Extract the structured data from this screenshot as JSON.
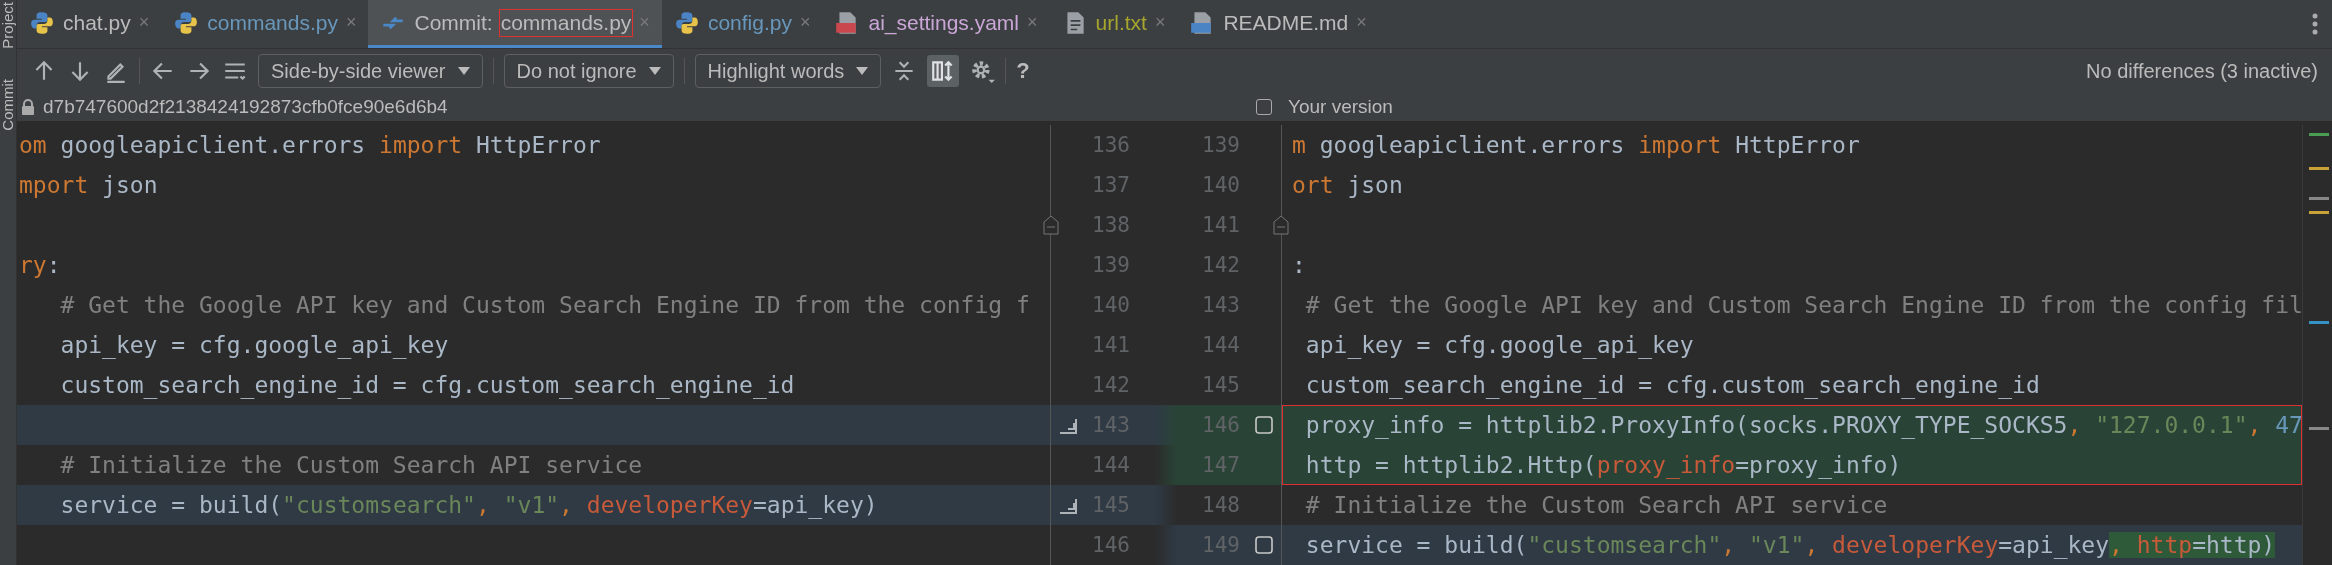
{
  "side_tabs": [
    {
      "label": "Project"
    },
    {
      "label": "Commit"
    }
  ],
  "tabs": [
    {
      "kind": "python",
      "label": "chat.py",
      "close": "×",
      "color": "#bbbbbb",
      "selected": false
    },
    {
      "kind": "python",
      "label": "commands.py",
      "close": "×",
      "color": "#6897bb",
      "selected": false
    },
    {
      "kind": "commit",
      "label": "Commit:",
      "file": "commands.py",
      "file_boxed": true,
      "close": "×",
      "color": "#bbbbbb",
      "selected": true
    },
    {
      "kind": "python",
      "label": "config.py",
      "close": "×",
      "color": "#6897bb",
      "selected": false
    },
    {
      "kind": "yaml",
      "label": "ai_settings.yaml",
      "close": "×",
      "color": "#c9a6d6",
      "selected": false
    },
    {
      "kind": "text",
      "label": "url.txt",
      "close": "×",
      "color": "#a6a62e",
      "selected": false
    },
    {
      "kind": "markdown",
      "label": "README.md",
      "close": "×",
      "color": "#bbbbbb",
      "selected": false
    }
  ],
  "toolbar": {
    "dropdowns": [
      "Side-by-side viewer",
      "Do not ignore",
      "Highlight words"
    ],
    "help": "?",
    "status": "No differences (3 inactive)"
  },
  "header": {
    "left_revision": "d7b747600d2f2138424192873cfb0fce90e6d6b4",
    "right_checked": false,
    "right_label": "Your version"
  },
  "rows": [
    {
      "left_no": "136",
      "right_no": "139",
      "left_modified": false,
      "right_added": false,
      "right_modified": false,
      "left_action": false,
      "right_check": false,
      "fold": false,
      "boxed": false,
      "left": [
        {
          "kind": "kw",
          "text": "om"
        },
        {
          "kind": "plain",
          "text": " googleapiclient.errors "
        },
        {
          "kind": "kw",
          "text": "import"
        },
        {
          "kind": "plain",
          "text": " HttpError"
        }
      ],
      "right": [
        {
          "kind": "kw",
          "text": "m"
        },
        {
          "kind": "plain",
          "text": " googleapiclient.errors "
        },
        {
          "kind": "kw",
          "text": "import"
        },
        {
          "kind": "plain",
          "text": " HttpError"
        }
      ]
    },
    {
      "left_no": "137",
      "right_no": "140",
      "left_modified": false,
      "right_added": false,
      "right_modified": false,
      "left_action": false,
      "right_check": false,
      "fold": false,
      "boxed": false,
      "left": [
        {
          "kind": "kw",
          "text": "mport"
        },
        {
          "kind": "plain",
          "text": " json"
        }
      ],
      "right": [
        {
          "kind": "kw",
          "text": "ort"
        },
        {
          "kind": "plain",
          "text": " json"
        }
      ]
    },
    {
      "left_no": "138",
      "right_no": "141",
      "left_modified": false,
      "right_added": false,
      "right_modified": false,
      "left_action": false,
      "right_check": false,
      "fold": true,
      "boxed": false,
      "left": [],
      "right": []
    },
    {
      "left_no": "139",
      "right_no": "142",
      "left_modified": false,
      "right_added": false,
      "right_modified": false,
      "left_action": false,
      "right_check": false,
      "fold": false,
      "boxed": false,
      "left": [
        {
          "kind": "kw",
          "text": "ry"
        },
        {
          "kind": "plain",
          "text": ":"
        }
      ],
      "right": [
        {
          "kind": "plain",
          "text": ":"
        }
      ]
    },
    {
      "left_no": "140",
      "right_no": "143",
      "left_modified": false,
      "right_added": false,
      "right_modified": false,
      "left_action": false,
      "right_check": false,
      "fold": false,
      "boxed": false,
      "left": [
        {
          "kind": "comment",
          "text": "   # Get the Google API key and Custom Search Engine ID from the config f"
        }
      ],
      "right": [
        {
          "kind": "comment",
          "text": " # Get the Google API key and Custom Search Engine ID from the config fil"
        }
      ]
    },
    {
      "left_no": "141",
      "right_no": "144",
      "left_modified": false,
      "right_added": false,
      "right_modified": false,
      "left_action": false,
      "right_check": false,
      "fold": false,
      "boxed": false,
      "left": [
        {
          "kind": "plain",
          "text": "   api_key = cfg.google_api_key"
        }
      ],
      "right": [
        {
          "kind": "plain",
          "text": " api_key = cfg.google_api_key"
        }
      ]
    },
    {
      "left_no": "142",
      "right_no": "145",
      "left_modified": false,
      "right_added": false,
      "right_modified": false,
      "left_action": false,
      "right_check": false,
      "fold": false,
      "boxed": false,
      "left": [
        {
          "kind": "plain",
          "text": "   custom_search_engine_id = cfg.custom_search_engine_id"
        }
      ],
      "right": [
        {
          "kind": "plain",
          "text": " custom_search_engine_id = cfg.custom_search_engine_id"
        }
      ]
    },
    {
      "left_no": "143",
      "right_no": "146",
      "left_modified": true,
      "right_added": true,
      "right_modified": false,
      "left_action": true,
      "right_check": true,
      "fold": false,
      "boxed": true,
      "left": [],
      "right": [
        {
          "kind": "plain",
          "text": " proxy_info = httplib2.ProxyInfo(socks.PROXY_TYPE_SOCKS5"
        },
        {
          "kind": "kw",
          "text": ", "
        },
        {
          "kind": "str",
          "text": "\"127.0.0.1\""
        },
        {
          "kind": "kw",
          "text": ", "
        },
        {
          "kind": "num",
          "text": "47"
        }
      ]
    },
    {
      "left_no": "144",
      "right_no": "147",
      "left_modified": false,
      "right_added": true,
      "right_modified": false,
      "left_action": false,
      "right_check": false,
      "fold": false,
      "boxed": true,
      "left": [
        {
          "kind": "comment",
          "text": "   # Initialize the Custom Search API service"
        }
      ],
      "right": [
        {
          "kind": "plain",
          "text": " http = httplib2.Http("
        },
        {
          "kind": "param",
          "text": "proxy_info"
        },
        {
          "kind": "plain",
          "text": "=proxy_info)"
        }
      ]
    },
    {
      "left_no": "145",
      "right_no": "148",
      "left_modified": true,
      "right_added": false,
      "right_modified": false,
      "left_action": true,
      "right_check": false,
      "fold": false,
      "boxed": false,
      "left": [
        {
          "kind": "plain",
          "text": "   service = build("
        },
        {
          "kind": "str",
          "text": "\"customsearch\""
        },
        {
          "kind": "kw",
          "text": ", "
        },
        {
          "kind": "str",
          "text": "\"v1\""
        },
        {
          "kind": "kw",
          "text": ", "
        },
        {
          "kind": "param",
          "text": "developerKey"
        },
        {
          "kind": "plain",
          "text": "=api_key)"
        }
      ],
      "right": [
        {
          "kind": "comment",
          "text": " # Initialize the Custom Search API service"
        }
      ]
    },
    {
      "left_no": "146",
      "right_no": "149",
      "left_modified": false,
      "right_added": false,
      "right_modified": true,
      "left_action": false,
      "right_check": true,
      "fold": false,
      "boxed": false,
      "left": [],
      "right": [
        {
          "kind": "plain",
          "text": " service = build("
        },
        {
          "kind": "str",
          "text": "\"customsearch\""
        },
        {
          "kind": "kw",
          "text": ", "
        },
        {
          "kind": "str",
          "text": "\"v1\""
        },
        {
          "kind": "kw",
          "text": ", "
        },
        {
          "kind": "param",
          "text": "developerKey"
        },
        {
          "kind": "plain",
          "text": "=api_key"
        },
        {
          "kind": "kw",
          "text": ", ",
          "added": true
        },
        {
          "kind": "param",
          "text": "http",
          "added": true
        },
        {
          "kind": "plain",
          "text": "=http)",
          "added": true
        }
      ]
    }
  ]
}
